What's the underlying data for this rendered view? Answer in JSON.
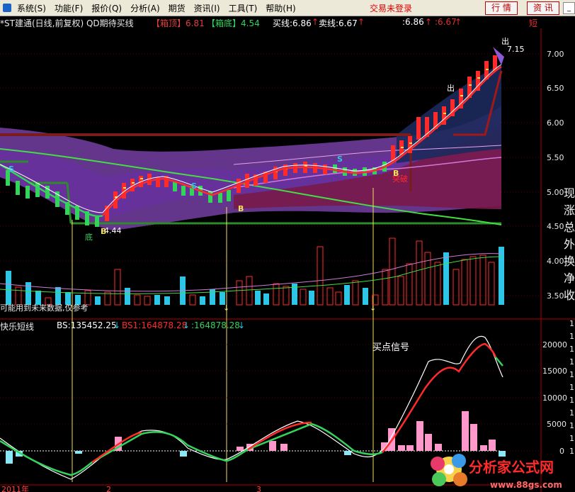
{
  "menu": {
    "items": [
      "系统(S)",
      "功能(F)",
      "报价(Q)",
      "分析(A)",
      "期货",
      "资讯(I)",
      "工具(T)",
      "帮助(H)"
    ],
    "status": "交易未登录",
    "trade_button": "行 情",
    "info_button": "资 讯"
  },
  "colors": {
    "background": "#000000",
    "up": "#ff2a2a",
    "down": "#33d35c",
    "cyan": "#2ec6e6",
    "pink": "#ff99cc",
    "purple": "#7a3fbf",
    "magenta": "#d27ad8",
    "maroon": "#8b1a1a",
    "green_line": "#44dd44",
    "yellow_line": "#f2e15c"
  },
  "main_header": {
    "title": "*ST建通(日线,前复权) QD期待买线",
    "box_top_label": "【箱顶】6.81",
    "box_bottom_label": "【箱底】4.54",
    "buy_label": "买线:6.86",
    "sell_label": "卖线:6.67",
    "v1": ":6.86",
    "v2": ":6.67",
    "short_tag": "短",
    "up_arrow": "↑"
  },
  "main_chart": {
    "price_ticks": [
      "7.00",
      "6.50",
      "6.00",
      "5.50",
      "5.00",
      "4.50",
      "4.00",
      "3.50"
    ],
    "annotations": {
      "out1": "出",
      "out2": "出",
      "high": "7.15",
      "low": "4.44",
      "bottom": "底",
      "top_break": "突破",
      "b_marks": [
        "B",
        "B",
        "B"
      ],
      "s_marks": [
        "S",
        "S",
        "S"
      ]
    },
    "volume_note": "可能用到未来数据,仅参考",
    "right_side_text": [
      "现",
      "涨",
      "总",
      "外",
      "换",
      "净",
      "收"
    ]
  },
  "sub_header": {
    "title": "快乐短线",
    "bs_label": "BS:135452.25",
    "bs1_label": "BS1:164878.28",
    "v3": ":164878.28",
    "down_arrow": "↓"
  },
  "sub_chart": {
    "ticks": [
      "20000",
      "15000",
      "10000",
      "5000",
      "0"
    ],
    "signal_label": "买点信号",
    "right_side_ticks": [
      "1",
      "1",
      "1",
      "1",
      "1",
      "1",
      "1",
      "1",
      "1",
      "1",
      "1"
    ],
    "x_ticks": [
      "2011年",
      "2",
      "3"
    ]
  },
  "watermark": {
    "site_name": "分析家公式网",
    "url": "www.88gs.com"
  }
}
